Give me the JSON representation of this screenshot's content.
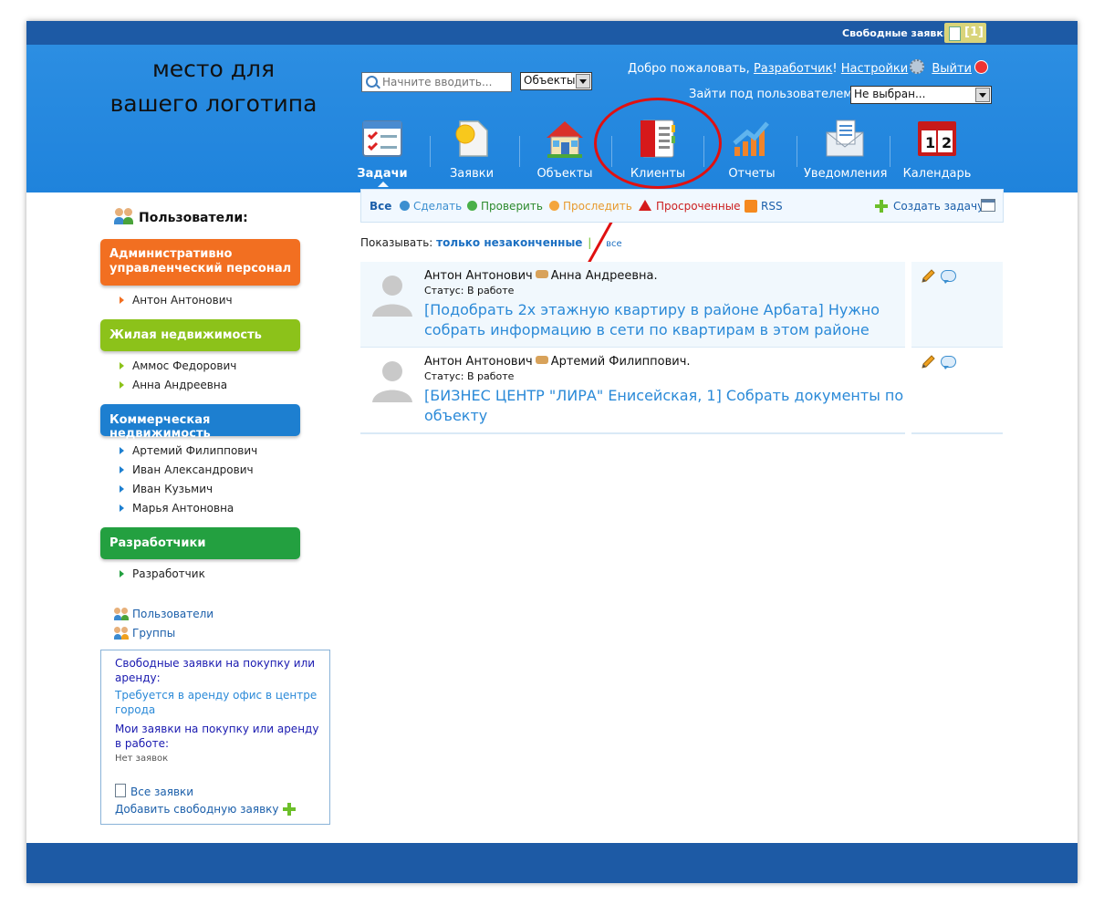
{
  "topbar": {
    "free_label": "Свободные заявки",
    "free_count": "[1]"
  },
  "logo": {
    "line1": "место для",
    "line2": "вашего логотипа"
  },
  "search": {
    "placeholder": "Начните вводить...",
    "scope_value": "Объекты"
  },
  "welcome": {
    "greeting": "Добро пожаловать, ",
    "user": "Разработчик",
    "excl": "!",
    "settings": "Настройки",
    "logout": "Выйти"
  },
  "impersonate": {
    "label": "Зайти под пользователем:",
    "value": "Не выбран..."
  },
  "nav": {
    "items": [
      {
        "label": "Задачи"
      },
      {
        "label": "Заявки"
      },
      {
        "label": "Объекты"
      },
      {
        "label": "Клиенты"
      },
      {
        "label": "Отчеты"
      },
      {
        "label": "Уведомления"
      },
      {
        "label": "Календарь"
      }
    ]
  },
  "filters": {
    "all": "Все",
    "todo": "Сделать",
    "check": "Проверить",
    "track": "Проследить",
    "overdue": "Просроченные",
    "rss": "RSS",
    "create": "Создать задачу"
  },
  "show": {
    "label": "Показывать: ",
    "unfinished": "только незаконченные",
    "sep": "|",
    "all": "все"
  },
  "tasks": [
    {
      "from": "Антон Антонович",
      "to": "Анна Андреевна.",
      "status": "Статус: В работе",
      "desc": "[Подобрать 2х этажную квартиру в районе Арбата] Нужно собрать информацию в сети по квартирам в этом районе"
    },
    {
      "from": "Антон Антонович",
      "to": "Артемий Филиппович.",
      "status": "Статус: В работе",
      "desc": "[БИЗНЕС ЦЕНТР \"ЛИРА\" Енисейская, 1] Собрать документы по объекту"
    }
  ],
  "sidebar": {
    "title": "Пользователи:",
    "groups": [
      {
        "name": "Административно управленческий персонал",
        "color": "#f26f21",
        "members": [
          "Антон Антонович"
        ]
      },
      {
        "name": "Жилая недвижимость",
        "color": "#8cc21a",
        "members": [
          "Аммос Федорович",
          "Анна Андреевна"
        ]
      },
      {
        "name": "Коммерческая недвижимость",
        "color": "#1d7fd0",
        "members": [
          "Артемий Филиппович",
          "Иван Александрович",
          "Иван Кузьмич",
          "Марья Антоновна"
        ]
      },
      {
        "name": "Разработчики",
        "color": "#23a040",
        "members": [
          "Разработчик"
        ]
      }
    ],
    "links": {
      "users": "Пользователи",
      "groups": "Группы"
    }
  },
  "requests_box": {
    "free_title": "Свободные заявки на покупку или аренду:",
    "free_item": "Требуется в аренду офис в центре города",
    "mine_title": "Мои заявки на покупку или аренду в работе:",
    "mine_empty": "Нет заявок",
    "all_link": "Все заявки",
    "add_link": "Добавить свободную заявку"
  }
}
